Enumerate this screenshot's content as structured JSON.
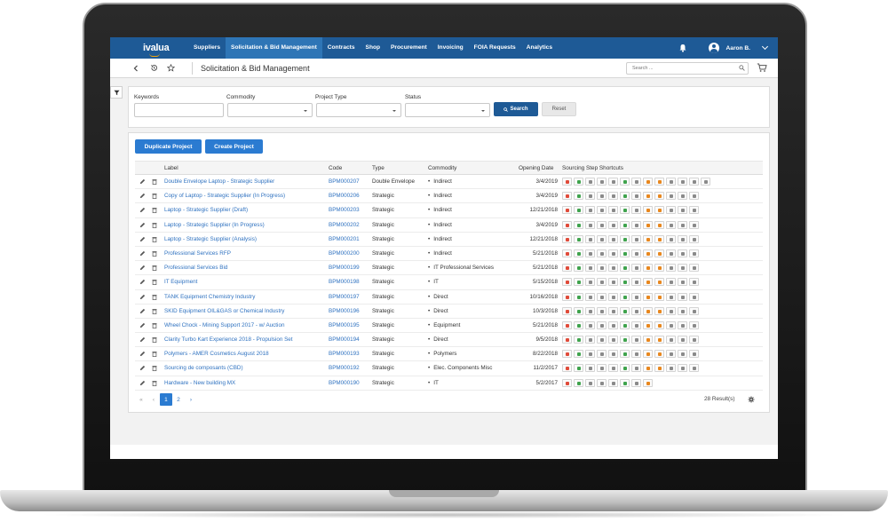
{
  "app": {
    "logo": "ivalua"
  },
  "nav": {
    "items": [
      {
        "label": "Suppliers",
        "active": false
      },
      {
        "label": "Solicitation & Bid Management",
        "active": true
      },
      {
        "label": "Contracts",
        "active": false
      },
      {
        "label": "Shop",
        "active": false
      },
      {
        "label": "Procurement",
        "active": false
      },
      {
        "label": "Invoicing",
        "active": false
      },
      {
        "label": "FOIA Requests",
        "active": false
      },
      {
        "label": "Analytics",
        "active": false
      }
    ],
    "user_name": "Aaron B."
  },
  "titlebar": {
    "page_title": "Solicitation & Bid Management",
    "search_placeholder": "Search ..."
  },
  "filters": {
    "keywords_label": "Keywords",
    "commodity_label": "Commodity",
    "project_type_label": "Project Type",
    "status_label": "Status",
    "search_button": "Search",
    "reset_button": "Reset"
  },
  "actions": {
    "duplicate": "Duplicate Project",
    "create": "Create Project"
  },
  "table": {
    "headers": {
      "label": "Label",
      "code": "Code",
      "type": "Type",
      "commodity": "Commodity",
      "opening_date": "Opening Date",
      "shortcuts": "Sourcing Step Shortcuts"
    },
    "rows": [
      {
        "label": "Double Envelope Laptop - Strategic Supplier",
        "code": "BPM000207",
        "type": "Double Envelope",
        "commodity": "Indirect",
        "date": "3/4/2019",
        "n_shortcuts": 13
      },
      {
        "label": "Copy of Laptop - Strategic Supplier (In Progress)",
        "code": "BPM000206",
        "type": "Strategic",
        "commodity": "Indirect",
        "date": "3/4/2019",
        "n_shortcuts": 12
      },
      {
        "label": "Laptop - Strategic Supplier (Draft)",
        "code": "BPM000203",
        "type": "Strategic",
        "commodity": "Indirect",
        "date": "12/21/2018",
        "n_shortcuts": 12
      },
      {
        "label": "Laptop - Strategic Supplier (In Progress)",
        "code": "BPM000202",
        "type": "Strategic",
        "commodity": "Indirect",
        "date": "3/4/2019",
        "n_shortcuts": 12
      },
      {
        "label": "Laptop - Strategic Supplier (Analysis)",
        "code": "BPM000201",
        "type": "Strategic",
        "commodity": "Indirect",
        "date": "12/21/2018",
        "n_shortcuts": 12
      },
      {
        "label": "Professional Services RFP",
        "code": "BPM000200",
        "type": "Strategic",
        "commodity": "Indirect",
        "date": "5/21/2018",
        "n_shortcuts": 12
      },
      {
        "label": "Professional Services Bid",
        "code": "BPM000199",
        "type": "Strategic",
        "commodity": "IT Professional Services",
        "date": "5/21/2018",
        "n_shortcuts": 12
      },
      {
        "label": "IT Equipment",
        "code": "BPM000198",
        "type": "Strategic",
        "commodity": "IT",
        "date": "5/15/2018",
        "n_shortcuts": 12
      },
      {
        "label": "TANK Equipment Chemistry Industry",
        "code": "BPM000197",
        "type": "Strategic",
        "commodity": "Direct",
        "date": "10/16/2018",
        "n_shortcuts": 12
      },
      {
        "label": "SKID Equipment OIL&GAS or Chemical Industry",
        "code": "BPM000196",
        "type": "Strategic",
        "commodity": "Direct",
        "date": "10/3/2018",
        "n_shortcuts": 12
      },
      {
        "label": "Wheel Chock - Mining Support 2017 - w/ Auction",
        "code": "BPM000195",
        "type": "Strategic",
        "commodity": "Equipment",
        "date": "5/21/2018",
        "n_shortcuts": 12
      },
      {
        "label": "Clarity Turbo Kart Experience 2018 - Propulsion Set",
        "code": "BPM000194",
        "type": "Strategic",
        "commodity": "Direct",
        "date": "9/5/2018",
        "n_shortcuts": 12
      },
      {
        "label": "Polymers - AMER Cosmetics August 2018",
        "code": "BPM000193",
        "type": "Strategic",
        "commodity": "Polymers",
        "date": "8/22/2018",
        "n_shortcuts": 12
      },
      {
        "label": "Sourcing de composants (CBD)",
        "code": "BPM000192",
        "type": "Strategic",
        "commodity": "Elec. Components Misc",
        "date": "11/2/2017",
        "n_shortcuts": 12
      },
      {
        "label": "Hardware - New building MX",
        "code": "BPM000190",
        "type": "Strategic",
        "commodity": "IT",
        "date": "5/2/2017",
        "n_shortcuts": 8
      }
    ]
  },
  "pagination": {
    "first": "«",
    "prev": "‹",
    "pages": [
      "1",
      "2"
    ],
    "current": "1",
    "next": "›",
    "results": "28 Result(s)"
  },
  "colors": {
    "nav_bg": "#1e5a96",
    "nav_active": "#2e75b6",
    "link": "#2f72c0",
    "primary_button": "#2b7bd1",
    "search_button": "#1e5a96",
    "shortcut_red": "#e04b3a",
    "shortcut_green": "#3fa34d",
    "shortcut_orange": "#e8871e",
    "shortcut_grey": "#8a8a8a"
  },
  "icons": [
    "bell-icon",
    "user-avatar-icon",
    "chevron-down-icon",
    "back-icon",
    "history-icon",
    "star-icon",
    "search-icon",
    "cart-icon",
    "filter-icon",
    "edit-icon",
    "delete-icon",
    "gear-icon"
  ]
}
